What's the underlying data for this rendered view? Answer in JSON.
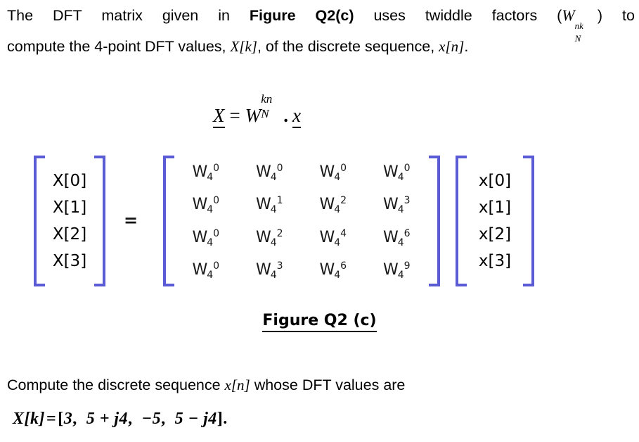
{
  "document": {
    "intro": {
      "line1_part1": "The DFT matrix given in ",
      "line1_bold": "Figure Q2(c)",
      "line1_part2": " uses twiddle factors (",
      "line1_w_base": "W",
      "line1_w_sub": "N",
      "line1_w_sup": "nk",
      "line1_part3": ") to",
      "line2_part1": "compute the 4-point DFT values, ",
      "line2_Xk": "X[k]",
      "line2_part2": ", of the discrete sequence, ",
      "line2_xn": "x[n]",
      "line2_part3": "."
    },
    "display_equation": {
      "lhs": "X",
      "equals": "=",
      "w_base": "W",
      "w_sub": "N",
      "w_sup": "kn",
      "dot": ".",
      "rhs": "x"
    },
    "matrix_equation": {
      "output_vector_label": "X-vector",
      "output_vector": [
        "X[0]",
        "X[1]",
        "X[2]",
        "X[3]"
      ],
      "equals": "=",
      "twiddle_matrix_symbol": "W",
      "twiddle_matrix_subscript": "4",
      "twiddle_matrix_exponents": [
        [
          "0",
          "0",
          "0",
          "0"
        ],
        [
          "0",
          "1",
          "2",
          "3"
        ],
        [
          "0",
          "2",
          "4",
          "6"
        ],
        [
          "0",
          "3",
          "6",
          "9"
        ]
      ],
      "input_vector_label": "x-vector",
      "input_vector": [
        "x[0]",
        "x[1]",
        "x[2]",
        "x[3]"
      ],
      "bracket_color": "#5b5bd6"
    },
    "figure_caption": "Figure Q2 (c)",
    "closing": {
      "part1": "Compute the discrete sequence ",
      "xn": "x[n]",
      "part2": " whose DFT values are"
    },
    "given": {
      "lhs": "X[k]",
      "equals": "=",
      "open_bracket": "[",
      "values": [
        "3",
        "5 + j4",
        "−5",
        "5 − j4"
      ],
      "close_bracket": "]",
      "period": "."
    }
  },
  "colors": {
    "text": "#000000",
    "bracket_blue": "#5b5bd6",
    "background": "#ffffff"
  }
}
